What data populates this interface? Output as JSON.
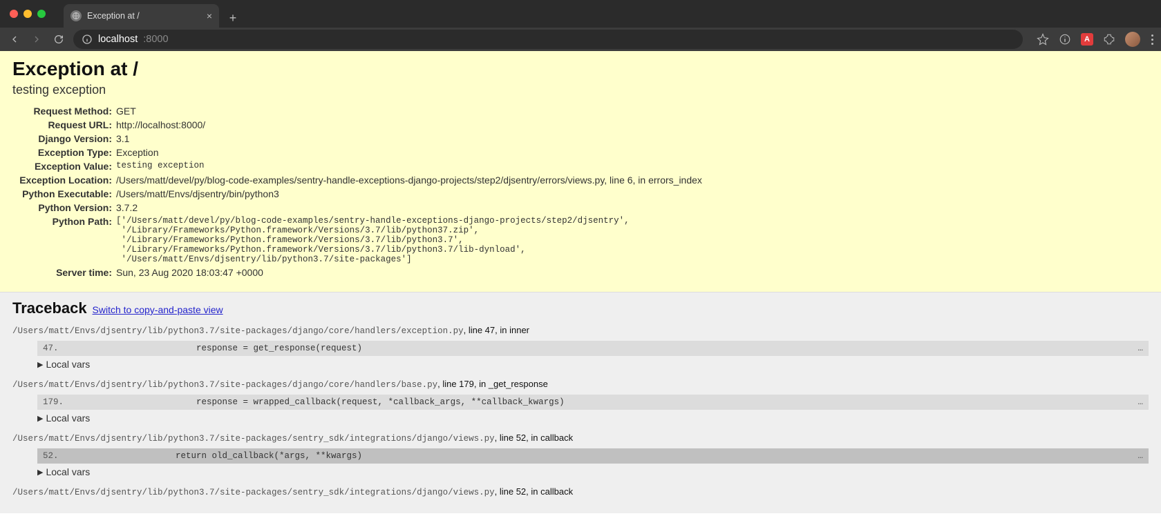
{
  "browser": {
    "tab": {
      "title": "Exception at /",
      "close": "×"
    },
    "new_tab": "+",
    "url": {
      "host": "localhost",
      "port": ":8000"
    },
    "ext_letter": "A"
  },
  "summary": {
    "heading": "Exception at /",
    "subtitle": "testing exception",
    "rows": {
      "request_method": {
        "label": "Request Method:",
        "value": "GET"
      },
      "request_url": {
        "label": "Request URL:",
        "value": "http://localhost:8000/"
      },
      "django_version": {
        "label": "Django Version:",
        "value": "3.1"
      },
      "exception_type": {
        "label": "Exception Type:",
        "value": "Exception"
      },
      "exception_value": {
        "label": "Exception Value:",
        "value": "testing exception"
      },
      "exception_location": {
        "label": "Exception Location:",
        "value": "/Users/matt/devel/py/blog-code-examples/sentry-handle-exceptions-django-projects/step2/djsentry/errors/views.py, line 6, in errors_index"
      },
      "python_executable": {
        "label": "Python Executable:",
        "value": "/Users/matt/Envs/djsentry/bin/python3"
      },
      "python_version": {
        "label": "Python Version:",
        "value": "3.7.2"
      },
      "python_path": {
        "label": "Python Path:",
        "value": "['/Users/matt/devel/py/blog-code-examples/sentry-handle-exceptions-django-projects/step2/djsentry',\n '/Library/Frameworks/Python.framework/Versions/3.7/lib/python37.zip',\n '/Library/Frameworks/Python.framework/Versions/3.7/lib/python3.7',\n '/Library/Frameworks/Python.framework/Versions/3.7/lib/python3.7/lib-dynload',\n '/Users/matt/Envs/djsentry/lib/python3.7/site-packages']"
      },
      "server_time": {
        "label": "Server time:",
        "value": "Sun, 23 Aug 2020 18:03:47 +0000"
      }
    }
  },
  "traceback": {
    "title": "Traceback",
    "switch_label": "Switch to copy-and-paste view",
    "local_vars_label": "Local vars",
    "ellipsis": "…",
    "frames": [
      {
        "path": "/Users/matt/Envs/djsentry/lib/python3.7/site-packages/django/core/handlers/exception.py",
        "loc": ", line 47, in inner",
        "lineno": "47.",
        "code": "            response = get_response(request)",
        "hl": false
      },
      {
        "path": "/Users/matt/Envs/djsentry/lib/python3.7/site-packages/django/core/handlers/base.py",
        "loc": ", line 179, in _get_response",
        "lineno": "179.",
        "code": "            response = wrapped_callback(request, *callback_args, **callback_kwargs)",
        "hl": false
      },
      {
        "path": "/Users/matt/Envs/djsentry/lib/python3.7/site-packages/sentry_sdk/integrations/django/views.py",
        "loc": ", line 52, in callback",
        "lineno": "52.",
        "code": "        return old_callback(*args, **kwargs)",
        "hl": true
      },
      {
        "path": "/Users/matt/Envs/djsentry/lib/python3.7/site-packages/sentry_sdk/integrations/django/views.py",
        "loc": ", line 52, in callback",
        "lineno": "",
        "code": "",
        "hl": false,
        "no_code": true
      }
    ]
  }
}
